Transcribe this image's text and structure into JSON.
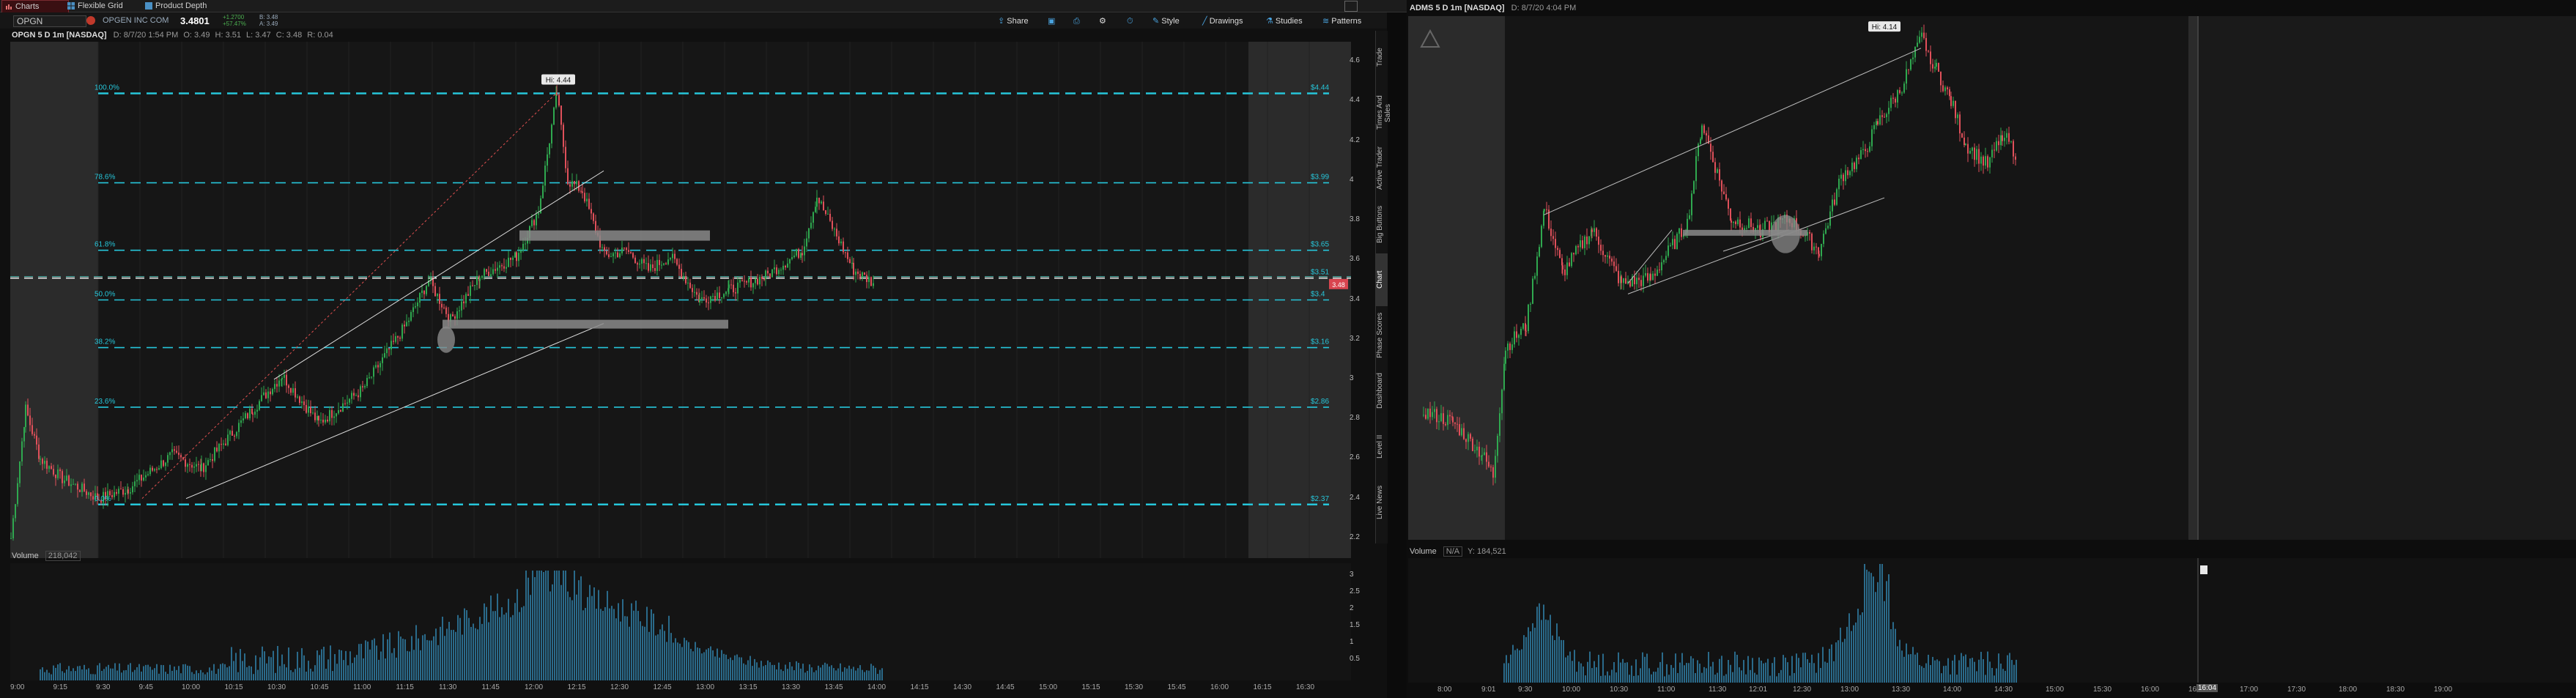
{
  "tabs": [
    {
      "label": "Charts",
      "icon": "chart-icon",
      "active": true
    },
    {
      "label": "Flexible Grid",
      "icon": "grid-icon",
      "active": false
    },
    {
      "label": "Product Depth",
      "icon": "depth-icon",
      "active": false
    }
  ],
  "left_chart": {
    "title": "OPGN 5 D 1m [NASDAQ]",
    "info": "D: 8/7/20 1:54 PM",
    "info_values": [
      "O: 3.49",
      "H: 3.51",
      "L: 3.47",
      "C: 3.48",
      "R: 0.04"
    ],
    "symbol": "OPGN",
    "company": "OPGEN INC COM",
    "last_price": "3.4801",
    "change": "+1.2700",
    "change_pct": "+57.47%",
    "bid": "B: 3.48",
    "ask": "A: 3.49",
    "toolbar": {
      "share": "Share",
      "style": "Style",
      "drawings": "Drawings",
      "studies": "Studies",
      "patterns": "Patterns"
    },
    "hi_label": "Hi: 4.44",
    "price_tag": "3.48",
    "fib_levels": [
      {
        "pct": "100.0%",
        "value": "$4.44"
      },
      {
        "pct": "78.6%",
        "value": "$3.99"
      },
      {
        "pct": "61.8%",
        "value": "$3.65"
      },
      {
        "pct": "50.0%",
        "value": "$3.4"
      },
      {
        "pct": "38.2%",
        "value": "$3.16"
      },
      {
        "pct": "23.6%",
        "value": "$2.86"
      },
      {
        "pct": "0.0%",
        "value": "$2.37"
      }
    ],
    "extra_level": "$3.51",
    "y_ticks": [
      "4.6",
      "4.4",
      "4.2",
      "4",
      "3.8",
      "3.6",
      "3.4",
      "3.2",
      "3",
      "2.8",
      "2.6",
      "2.4",
      "2.2"
    ],
    "volume_label": "Volume",
    "volume_value": "218,042",
    "vol_ticks": [
      "3",
      "2.5",
      "2",
      "1.5",
      "1",
      "0.5"
    ],
    "x_ticks": [
      "9:00",
      "9:15",
      "9:30",
      "9:45",
      "10:00",
      "10:15",
      "10:30",
      "10:45",
      "11:00",
      "11:15",
      "11:30",
      "11:45",
      "12:00",
      "12:15",
      "12:30",
      "12:45",
      "13:00",
      "13:15",
      "13:30",
      "13:45",
      "14:00",
      "14:15",
      "14:30",
      "14:45",
      "15:00",
      "15:15",
      "15:30",
      "15:45",
      "16:00",
      "16:15",
      "16:30"
    ]
  },
  "right_chart": {
    "title": "ADMS 5 D 1m [NASDAQ]",
    "info": "D: 8/7/20 4:04 PM",
    "hi_label": "Hi: 4.14",
    "volume_label": "Volume",
    "volume_na": "N/A",
    "volume_value": "Y: 184,521",
    "x_ticks": [
      "8:00",
      "9:01",
      "9:30",
      "10:00",
      "10:30",
      "11:00",
      "11:30",
      "12:01",
      "12:30",
      "13:00",
      "13:30",
      "14:00",
      "14:30",
      "15:00",
      "15:30",
      "16:00",
      "16:30",
      "17:00",
      "17:30",
      "18:00",
      "18:30",
      "19:00"
    ],
    "cursor_time": "16:04"
  },
  "side_tabs": [
    "Trade",
    "Times And Sales",
    "Active Trader",
    "Big Buttons",
    "Chart",
    "Phase Scores",
    "Dashboard",
    "Level II",
    "Live News"
  ],
  "colors": {
    "up": "#2fa84f",
    "down": "#e0505a",
    "fib": "#26c6da",
    "bg": "#101010",
    "expansion": "#2a2a2a"
  }
}
